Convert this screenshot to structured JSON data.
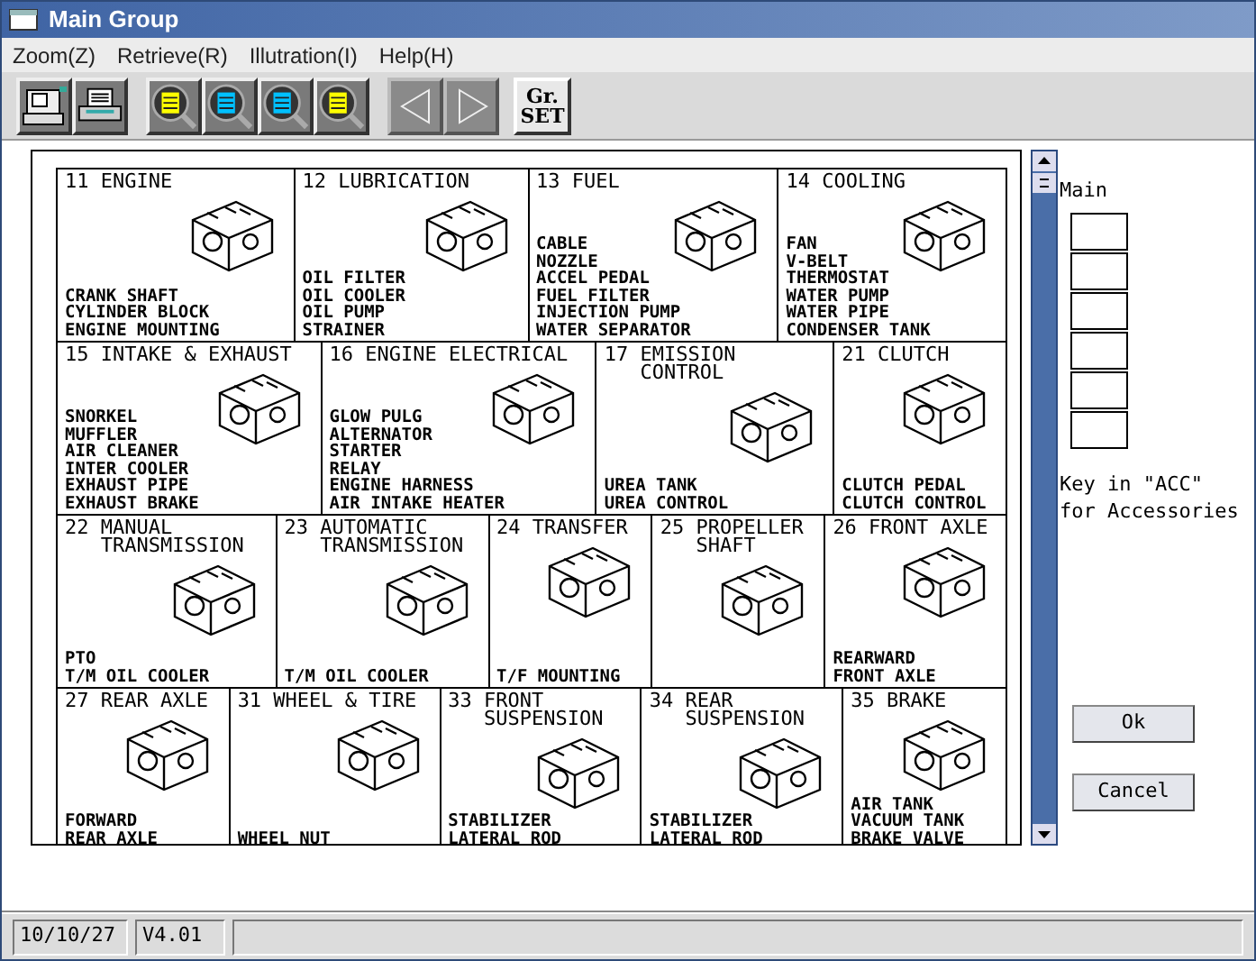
{
  "window": {
    "title": "Main Group"
  },
  "menu": [
    "Zoom(Z)",
    "Retrieve(R)",
    "Illutration(I)",
    "Help(H)"
  ],
  "toolbar": [
    {
      "kind": "computer",
      "disabled": false
    },
    {
      "kind": "printer",
      "disabled": false
    },
    {
      "kind": "magnifier",
      "color": "#ffff00",
      "disabled": false
    },
    {
      "kind": "magnifier",
      "color": "#00c0ff",
      "disabled": false
    },
    {
      "kind": "magnifier",
      "color": "#00c0ff",
      "disabled": false
    },
    {
      "kind": "magnifier",
      "color": "#ffff00",
      "disabled": false
    },
    {
      "kind": "arrow-left",
      "disabled": true
    },
    {
      "kind": "arrow-right",
      "disabled": true
    },
    {
      "kind": "text",
      "label": "Gr.\nSET",
      "disabled": false
    }
  ],
  "groups": [
    [
      {
        "title": [
          "11 ENGINE"
        ],
        "parts": [
          "CRANK SHAFT",
          "CYLINDER BLOCK",
          "ENGINE MOUNTING"
        ]
      },
      {
        "title": [
          "12 LUBRICATION"
        ],
        "parts": [
          "OIL FILTER",
          "OIL COOLER",
          "OIL PUMP",
          "STRAINER"
        ]
      },
      {
        "title": [
          "13 FUEL"
        ],
        "parts": [
          "CABLE",
          "NOZZLE",
          "ACCEL PEDAL",
          "FUEL FILTER",
          "INJECTION PUMP",
          "WATER SEPARATOR"
        ]
      },
      {
        "title": [
          "14 COOLING"
        ],
        "parts": [
          "FAN",
          "V-BELT",
          "THERMOSTAT",
          "WATER PUMP",
          "WATER PIPE",
          "CONDENSER TANK"
        ]
      }
    ],
    [
      {
        "title": [
          "15 INTAKE & EXHAUST"
        ],
        "parts": [
          "SNORKEL",
          "MUFFLER",
          "AIR CLEANER",
          "INTER COOLER",
          "EXHAUST PIPE",
          "EXHAUST BRAKE"
        ]
      },
      {
        "title": [
          "16 ENGINE ELECTRICAL"
        ],
        "parts": [
          "GLOW PULG",
          "ALTERNATOR",
          "STARTER",
          "RELAY",
          "ENGINE HARNESS",
          "AIR INTAKE HEATER"
        ]
      },
      {
        "title": [
          "17 EMISSION",
          "CONTROL"
        ],
        "parts": [
          "UREA TANK",
          "UREA CONTROL"
        ]
      },
      {
        "title": [
          "21 CLUTCH"
        ],
        "parts": [
          "CLUTCH PEDAL",
          "CLUTCH CONTROL"
        ]
      }
    ],
    [
      {
        "title": [
          "22 MANUAL",
          "TRANSMISSION"
        ],
        "parts": [
          "PTO",
          "T/M OIL COOLER"
        ]
      },
      {
        "title": [
          "23 AUTOMATIC",
          "TRANSMISSION"
        ],
        "parts": [
          "T/M OIL COOLER"
        ]
      },
      {
        "title": [
          "24 TRANSFER"
        ],
        "parts": [
          "T/F MOUNTING"
        ]
      },
      {
        "title": [
          "25 PROPELLER",
          "SHAFT"
        ]
      },
      {
        "title": [
          "26 FRONT AXLE"
        ],
        "parts": [
          "REARWARD",
          "FRONT AXLE"
        ]
      }
    ],
    [
      {
        "title": [
          "27 REAR AXLE"
        ],
        "parts": [
          "FORWARD",
          "REAR AXLE"
        ]
      },
      {
        "title": [
          "31 WHEEL & TIRE"
        ],
        "parts": [
          "WHEEL NUT"
        ]
      },
      {
        "title": [
          "33 FRONT",
          "SUSPENSION"
        ],
        "parts": [
          "STABILIZER",
          "LATERAL ROD"
        ]
      },
      {
        "title": [
          "34 REAR",
          "SUSPENSION"
        ],
        "parts": [
          "STABILIZER",
          "LATERAL ROD"
        ]
      },
      {
        "title": [
          "35 BRAKE"
        ],
        "parts": [
          "AIR TANK",
          "VACUUM TANK",
          "BRAKE VALVE"
        ]
      }
    ]
  ],
  "side_panel": {
    "label": "Main",
    "key_note": [
      "Key in \"ACC\"",
      "for Accessories"
    ],
    "ok": "Ok",
    "cancel": "Cancel"
  },
  "status_bar": {
    "date": "10/10/27",
    "version": "V4.01"
  }
}
